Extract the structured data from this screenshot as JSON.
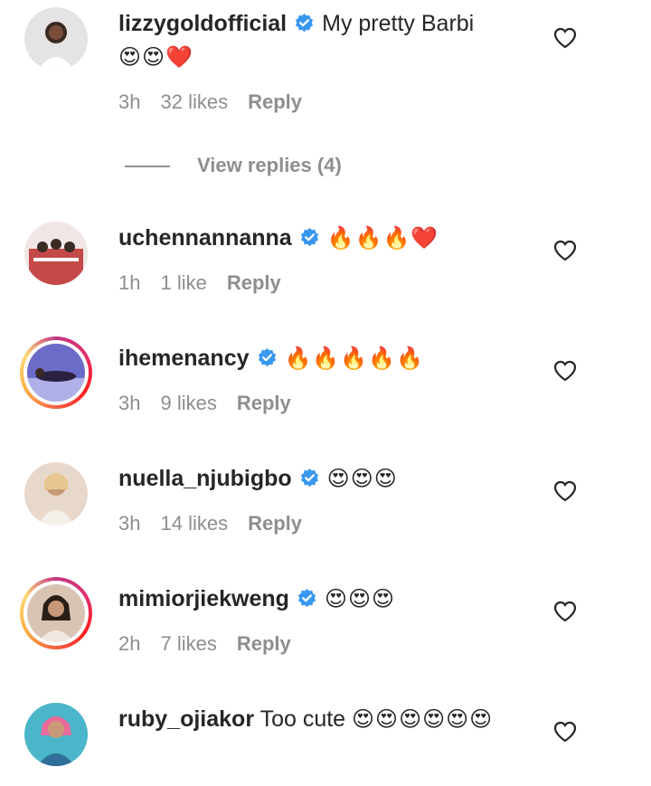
{
  "comments": [
    {
      "username": "lizzygoldofficial",
      "text": "My pretty Barbi",
      "emojis": "😍😍❤️",
      "time": "3h",
      "likes": "32 likes",
      "reply": "Reply",
      "avatar_color": "#d8d8d8",
      "story_ring": false
    },
    {
      "username": "uchennannanna",
      "text": "",
      "emojis": "🔥🔥🔥❤️",
      "time": "1h",
      "likes": "1 like",
      "reply": "Reply",
      "avatar_color": "#c44a4a",
      "story_ring": false
    },
    {
      "username": "ihemenancy",
      "text": "",
      "emojis": "🔥🔥🔥🔥🔥",
      "time": "3h",
      "likes": "9 likes",
      "reply": "Reply",
      "avatar_color": "#6b6bc8",
      "story_ring": true
    },
    {
      "username": "nuella_njubigbo",
      "text": "",
      "emojis": "😍😍😍",
      "time": "3h",
      "likes": "14 likes",
      "reply": "Reply",
      "avatar_color": "#d9a98a",
      "story_ring": false
    },
    {
      "username": "mimiorjiekweng",
      "text": "",
      "emojis": "😍😍😍",
      "time": "2h",
      "likes": "7 likes",
      "reply": "Reply",
      "avatar_color": "#b89680",
      "story_ring": true
    },
    {
      "username": "ruby_ojiakor",
      "text": "Too cute",
      "emojis": "😍😍😍😍😍😍",
      "time": "",
      "likes": "",
      "reply": "",
      "avatar_color": "#4bb6c9",
      "story_ring": false
    }
  ],
  "view_replies": "View replies (4)",
  "colors": {
    "verified": "#3897f0",
    "meta": "#8e8e8e",
    "text": "#262626"
  }
}
